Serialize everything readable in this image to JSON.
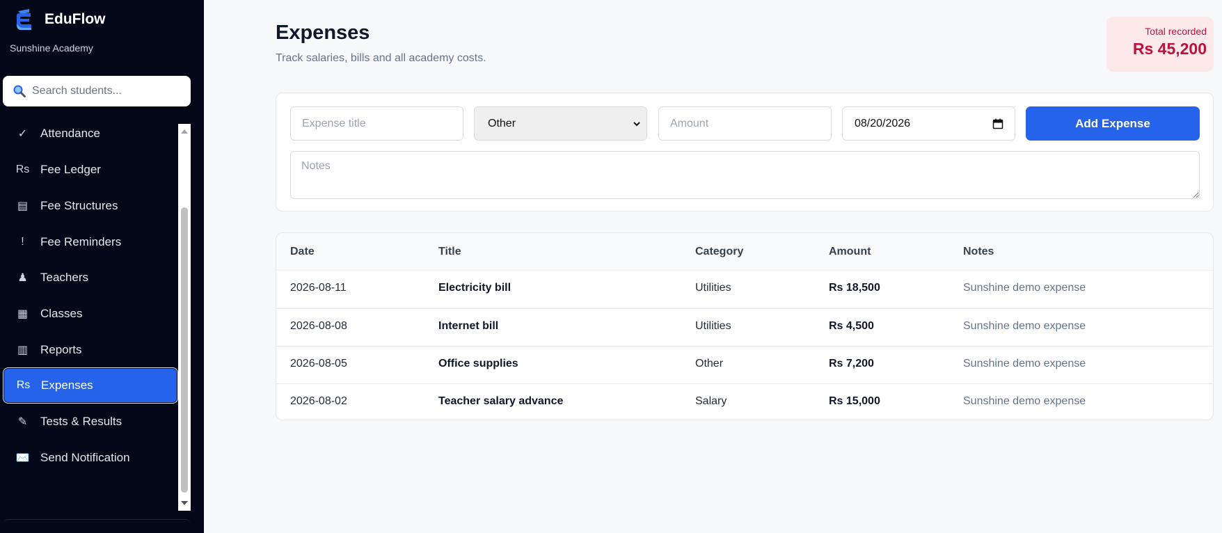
{
  "app": {
    "name": "EduFlow",
    "subtitle": "Sunshine Academy"
  },
  "search": {
    "placeholder": "Search students..."
  },
  "sidebar": {
    "items": [
      {
        "icon": "check-icon",
        "glyph": "✓",
        "label": "Attendance",
        "active": false
      },
      {
        "icon": "rupee-icon",
        "glyph": "Rs",
        "label": "Fee Ledger",
        "active": false
      },
      {
        "icon": "list-icon",
        "glyph": "▤",
        "label": "Fee Structures",
        "active": false
      },
      {
        "icon": "exclamation-icon",
        "glyph": "!",
        "label": "Fee Reminders",
        "active": false
      },
      {
        "icon": "teacher-icon",
        "glyph": "♟",
        "label": "Teachers",
        "active": false
      },
      {
        "icon": "grid-icon",
        "glyph": "▦",
        "label": "Classes",
        "active": false
      },
      {
        "icon": "reports-icon",
        "glyph": "▥",
        "label": "Reports",
        "active": false
      },
      {
        "icon": "rupee-icon",
        "glyph": "Rs",
        "label": "Expenses",
        "active": true
      },
      {
        "icon": "pencil-icon",
        "glyph": "✎",
        "label": "Tests & Results",
        "active": false
      },
      {
        "icon": "mail-icon",
        "glyph": "✉️",
        "label": "Send Notification",
        "active": false
      }
    ]
  },
  "header": {
    "title": "Expenses",
    "subtitle": "Track salaries, bills and all academy costs.",
    "total_label": "Total recorded",
    "total_value": "Rs 45,200"
  },
  "form": {
    "title_placeholder": "Expense title",
    "category_value": "Other",
    "amount_placeholder": "Amount",
    "date_value": "08/20/2026",
    "add_label": "Add Expense",
    "notes_placeholder": "Notes"
  },
  "table": {
    "headers": [
      "Date",
      "Title",
      "Category",
      "Amount",
      "Notes"
    ],
    "rows": [
      {
        "date": "2026-08-11",
        "title": "Electricity bill",
        "category": "Utilities",
        "amount": "Rs 18,500",
        "notes": "Sunshine demo expense"
      },
      {
        "date": "2026-08-08",
        "title": "Internet bill",
        "category": "Utilities",
        "amount": "Rs 4,500",
        "notes": "Sunshine demo expense"
      },
      {
        "date": "2026-08-05",
        "title": "Office supplies",
        "category": "Other",
        "amount": "Rs 7,200",
        "notes": "Sunshine demo expense"
      },
      {
        "date": "2026-08-02",
        "title": "Teacher salary advance",
        "category": "Salary",
        "amount": "Rs 15,000",
        "notes": "Sunshine demo expense"
      }
    ]
  },
  "colors": {
    "sidebar_bg": "#020817",
    "accent": "#2563eb",
    "total_bg": "#fde8ea",
    "total_text": "#be123c"
  }
}
